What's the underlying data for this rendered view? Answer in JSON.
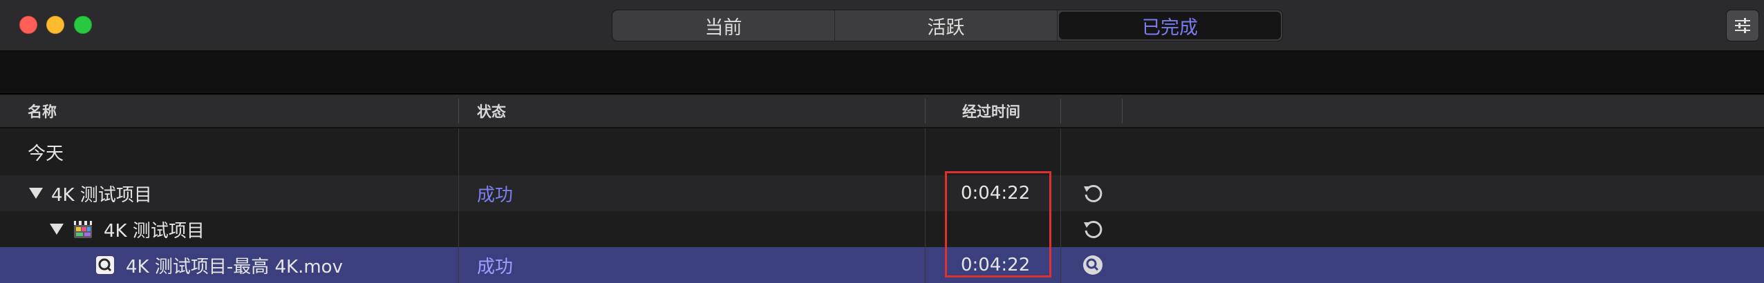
{
  "tabs": [
    {
      "label": "当前",
      "active": false
    },
    {
      "label": "活跃",
      "active": false
    },
    {
      "label": "已完成",
      "active": true
    }
  ],
  "columns": {
    "name": "名称",
    "status": "状态",
    "elapsed": "经过时间"
  },
  "group_label": "今天",
  "rows": [
    {
      "name": "4K 测试项目",
      "status": "成功",
      "elapsed": "0:04:22",
      "action_icon": "retry-icon"
    },
    {
      "name": "4K 测试项目",
      "status": "",
      "elapsed": "",
      "action_icon": "retry-icon"
    },
    {
      "name": "4K 测试项目-最高 4K.mov",
      "status": "成功",
      "elapsed": "0:04:22",
      "action_icon": "reveal-in-finder-icon"
    }
  ],
  "colors": {
    "accent": "#7b7bf2",
    "selection": "#3b3f7e",
    "highlight_box": "#e03131"
  }
}
